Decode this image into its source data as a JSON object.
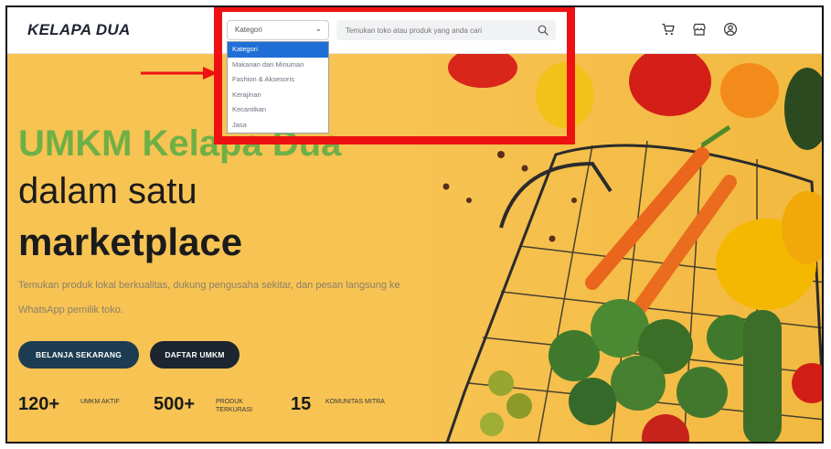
{
  "header": {
    "logo": "KELAPA DUA",
    "category_select": "Kategori",
    "search_placeholder": "Temukan toko atau produk yang anda cari"
  },
  "dropdown": {
    "options": [
      "Kategori",
      "Makanan dan Minuman",
      "Fashion & Aksesoris",
      "Kerajinan",
      "Kecantikan",
      "Jasa"
    ],
    "selected": "Kategori"
  },
  "hero": {
    "heading_green": "UMKM Kelapa Dua",
    "heading_line2": "dalam satu",
    "heading_line3": "marketplace",
    "description": "Temukan produk lokal berkualitas, dukung pengusaha sekitar, dan pesan langsung ke WhatsApp pemilik toko.",
    "primary_button": "BELANJA SEKARANG",
    "secondary_button": "DAFTAR UMKM"
  },
  "stats": [
    {
      "value": "120+",
      "label_1": "UMKM AKTIF",
      "label_2": ""
    },
    {
      "value": "500+",
      "label_1": "PRODUK",
      "label_2": "TERKURASI"
    },
    {
      "value": "15",
      "label_1": "KOMUNITAS MITRA",
      "label_2": ""
    }
  ],
  "colors": {
    "hero_bg": "#f7c353",
    "accent_green": "#6fb046",
    "primary_button": "#1d3c52",
    "secondary_button": "#1c2530",
    "annotation_red": "#ee1111",
    "dropdown_selected": "#1f6fd6"
  },
  "icons": [
    "search-icon",
    "cart-icon",
    "store-icon",
    "user-icon",
    "chevron-down-icon"
  ]
}
